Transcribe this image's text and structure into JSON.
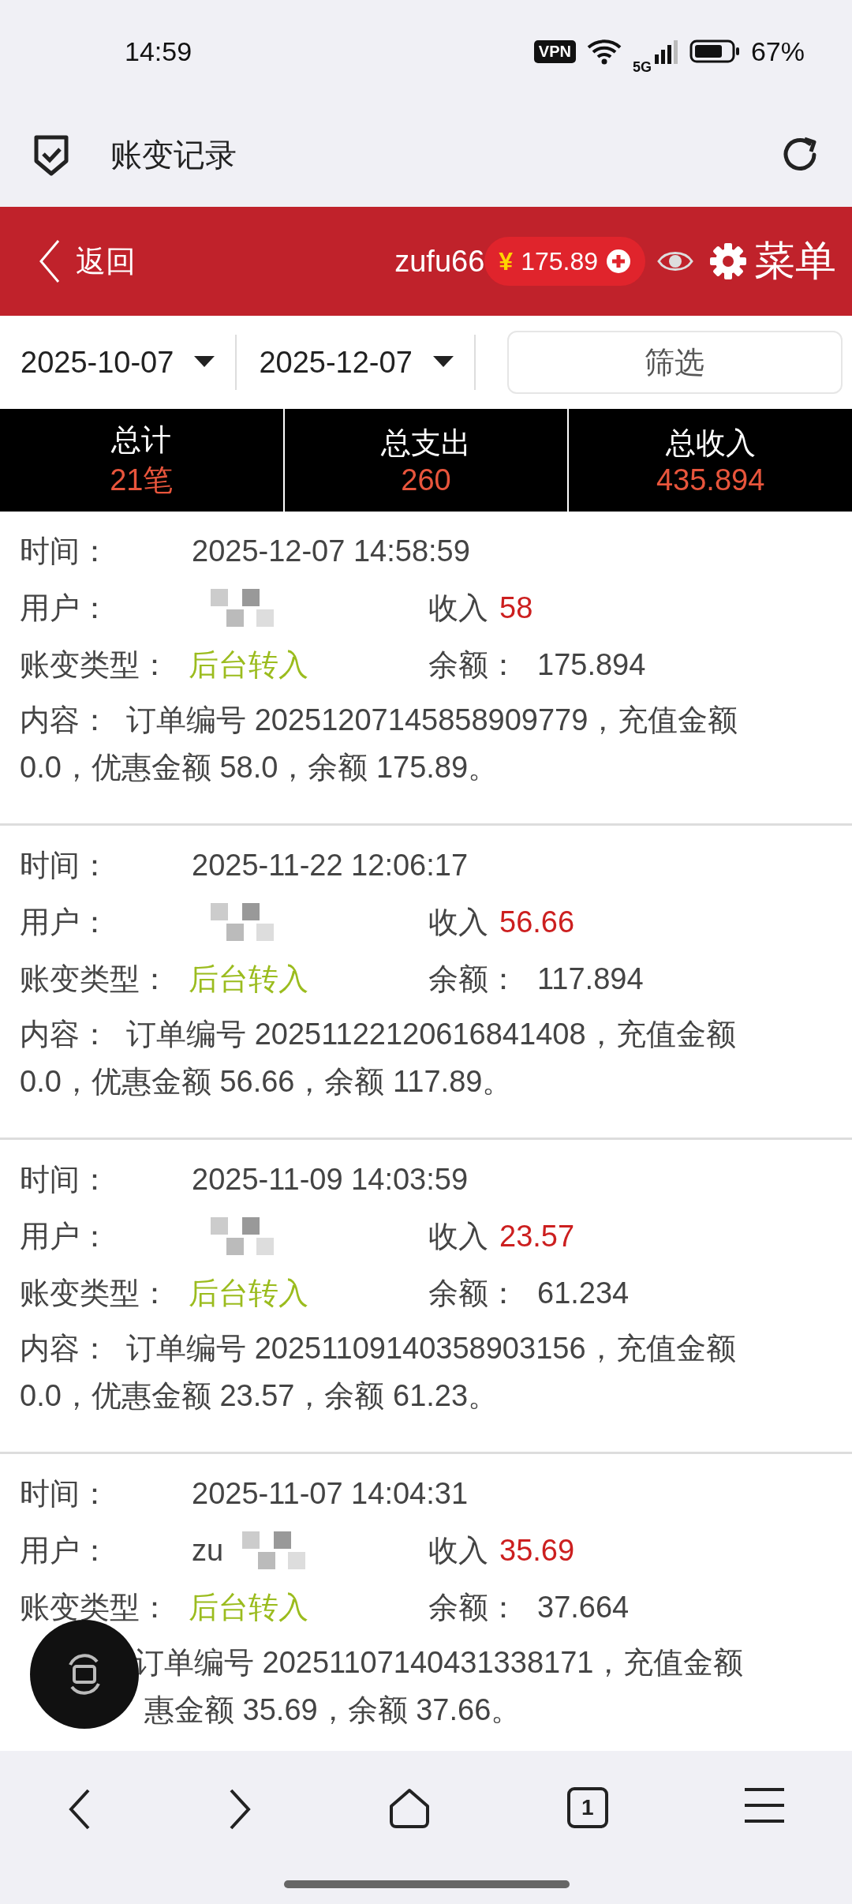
{
  "status_bar": {
    "time": "14:59",
    "vpn": "VPN",
    "network": "5G",
    "battery": "67%"
  },
  "browser": {
    "title": "账变记录"
  },
  "header": {
    "back": "返回",
    "username": "zufu66",
    "currency": "¥",
    "balance": "175.89",
    "menu": "菜单"
  },
  "filter": {
    "start_date": "2025-10-07",
    "end_date": "2025-12-07",
    "button": "筛选"
  },
  "summary": [
    {
      "label": "总计",
      "value": "21笔"
    },
    {
      "label": "总支出",
      "value": "260"
    },
    {
      "label": "总收入",
      "value": "435.894"
    }
  ],
  "records": [
    {
      "time_label": "时间：",
      "time": "2025-12-07 14:58:59",
      "user_label": "用户：",
      "income_label": "收入",
      "income": "58",
      "type_label": "账变类型：",
      "type": "后台转入",
      "balance_label": "余额：",
      "balance": "175.894",
      "content_label": "内容：",
      "content": "订单编号 20251207145858909779，充值金额 0.0，优惠金额 58.0，余额 175.89。"
    },
    {
      "time_label": "时间：",
      "time": "2025-11-22 12:06:17",
      "user_label": "用户：",
      "income_label": "收入",
      "income": "56.66",
      "type_label": "账变类型：",
      "type": "后台转入",
      "balance_label": "余额：",
      "balance": "117.894",
      "content_label": "内容：",
      "content": "订单编号 20251122120616841408，充值金额 0.0，优惠金额 56.66，余额 117.89。"
    },
    {
      "time_label": "时间：",
      "time": "2025-11-09 14:03:59",
      "user_label": "用户：",
      "income_label": "收入",
      "income": "23.57",
      "type_label": "账变类型：",
      "type": "后台转入",
      "balance_label": "余额：",
      "balance": "61.234",
      "content_label": "内容：",
      "content": "订单编号 20251109140358903156，充值金额 0.0，优惠金额 23.57，余额 61.23。"
    },
    {
      "time_label": "时间：",
      "time": "2025-11-07 14:04:31",
      "user_label": "用户：",
      "user": "zu",
      "income_label": "收入",
      "income": "35.69",
      "type_label": "账变类型：",
      "type": "后台转入",
      "balance_label": "余额：",
      "balance": "37.664",
      "content_lines": [
        "订单编号 20251107140431338171，充值金额",
        "惠金额 35.69，余额 37.66。"
      ]
    }
  ],
  "nav": {
    "tabs_count": "1"
  }
}
